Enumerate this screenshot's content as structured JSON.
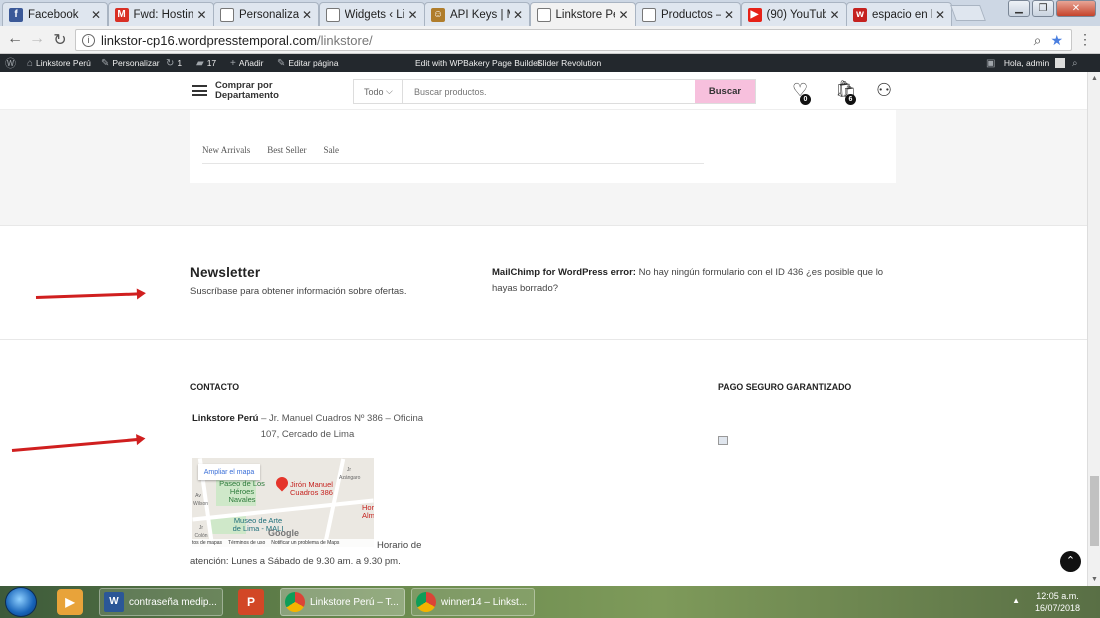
{
  "browser": {
    "tabs": [
      {
        "label": "Facebook",
        "icon": "facebook-icon",
        "color": "#3b5998",
        "glyph": "f"
      },
      {
        "label": "Fwd: Hosting",
        "icon": "gmail-icon",
        "color": "#d93025",
        "glyph": "M"
      },
      {
        "label": "Personalizar",
        "icon": "page-icon",
        "color": "",
        "glyph": ""
      },
      {
        "label": "Widgets ‹ Lin",
        "icon": "page-icon",
        "color": "",
        "glyph": ""
      },
      {
        "label": "API Keys | Ma",
        "icon": "mailchimp-icon",
        "color": "#b07d2b",
        "glyph": "☺"
      },
      {
        "label": "Linkstore Per",
        "icon": "page-icon",
        "color": "",
        "glyph": ""
      },
      {
        "label": "Productos – L",
        "icon": "page-icon",
        "color": "",
        "glyph": ""
      },
      {
        "label": "(90) YouTube",
        "icon": "youtube-icon",
        "color": "#e62117",
        "glyph": "▶"
      },
      {
        "label": "espacio en lo",
        "icon": "web-icon",
        "color": "#c5221f",
        "glyph": "w"
      }
    ],
    "close_glyph": "✕",
    "url_host": "linkstor-cp16.wordpresstemporal.com",
    "url_path": "/linkstore/"
  },
  "admin_bar": {
    "site": "Linkstore Perú",
    "customize": "Personalizar",
    "updates": "1",
    "comments": "17",
    "add_new": "Añadir",
    "edit_page": "Editar página",
    "wpbakery": "Edit with WPBakery Page Builder",
    "slider": "Slider Revolution",
    "greeting": "Hola, admin"
  },
  "header": {
    "dept_label": "Comprar por Departamento",
    "category": "Todo",
    "search_placeholder": "Buscar productos.",
    "search_button": "Buscar",
    "wishlist_count": "0",
    "cart_count": "6"
  },
  "product_tabs": [
    "New Arrivals",
    "Best Seller",
    "Sale"
  ],
  "newsletter": {
    "title": "Newsletter",
    "subtitle": "Suscríbase para obtener información sobre ofertas.",
    "error_label": "MailChimp for WordPress error:",
    "error_text": "No hay ningún formulario con el ID 436 ¿es posible que lo hayas borrado?"
  },
  "footer": {
    "contact_heading": "CONTACTO",
    "payment_heading": "PAGO SEGURO GARANTIZADO",
    "address_name": "Linkstore Perú",
    "address_text": " – Jr. Manuel Cuadros Nº 386 – Oficina 107, Cercado de Lima",
    "hours": "Horario de atención: Lunes a Sábado de 9.30 am. a 9.30 pm."
  },
  "map": {
    "enlarge": "Ampliar el mapa",
    "place1": "Paseo de Los Héroes Navales",
    "place2": "Jirón Manuel Cuadros 386",
    "place3": "Museo de Arte de Lima - MALI",
    "place4": "Hor Alm",
    "street1": "Av Wilson",
    "street2": "Jr Azángaro",
    "street3": "Jr Colón",
    "footer_data": "tos de mapas",
    "footer_terms": "Términos de uso",
    "footer_report": "Notificar un problema de Maps",
    "google": "Google"
  },
  "taskbar": {
    "items": [
      "contraseña medip...",
      "Linkstore Perú – T...",
      "winner14 – Linkst..."
    ],
    "time": "12:05 a.m.",
    "date": "16/07/2018"
  }
}
